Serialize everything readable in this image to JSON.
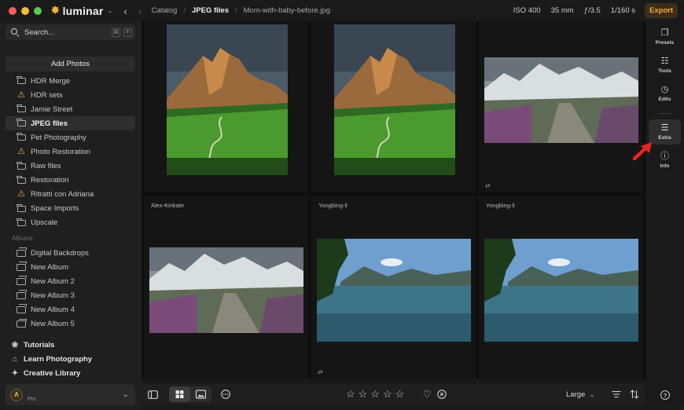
{
  "app": {
    "name": "luminar",
    "logo_glyph": "✸"
  },
  "breadcrumbs": [
    "Catalog",
    "JPEG files",
    "Mom-with-baby-before.jpg"
  ],
  "exif": {
    "iso": "ISO 400",
    "focal": "35 mm",
    "aperture": "ƒ/3.5",
    "shutter": "1/160 s"
  },
  "toolbar": {
    "export_label": "Export"
  },
  "search": {
    "placeholder": "Search...",
    "key1": "⌘",
    "key2": "F"
  },
  "sidebar": {
    "add_photos": "Add Photos",
    "folders": [
      {
        "label": "HDR Merge",
        "icon": "folder-icon"
      },
      {
        "label": "HDR sets",
        "icon": "warning-icon"
      },
      {
        "label": "Jamie Street",
        "icon": "folder-icon"
      },
      {
        "label": "JPEG files",
        "icon": "folder-icon",
        "active": true
      },
      {
        "label": "Pet Photography",
        "icon": "folder-icon"
      },
      {
        "label": "Photo Restoration",
        "icon": "warning-icon"
      },
      {
        "label": "Raw files",
        "icon": "folder-icon"
      },
      {
        "label": "Restoration",
        "icon": "folder-icon"
      },
      {
        "label": "Ritratti con Adriana",
        "icon": "warning-icon"
      },
      {
        "label": "Space Imports",
        "icon": "folder-icon"
      },
      {
        "label": "Upscale",
        "icon": "folder-icon"
      }
    ],
    "albums_heading": "Albums",
    "albums": [
      "Digital Backdrops",
      "New Album",
      "New Album 2",
      "New Album 3",
      "New Album 4",
      "New Album 5"
    ],
    "learn": [
      {
        "label": "Tutorials",
        "icon": "tutorials-icon"
      },
      {
        "label": "Learn Photography",
        "icon": "learn-icon"
      },
      {
        "label": "Creative Library",
        "icon": "library-icon"
      }
    ],
    "profile": {
      "initial": "A",
      "tier": "Pro"
    }
  },
  "grid": {
    "cells": [
      {
        "label": "",
        "photo": "mountain",
        "adjusted": false
      },
      {
        "label": "",
        "photo": "mountain",
        "adjusted": false
      },
      {
        "label": "",
        "photo": "snow",
        "adjusted": true
      },
      {
        "label": "Alex-Kinkate",
        "photo": "snow",
        "adjusted": false
      },
      {
        "label": "Yongbing-li",
        "photo": "lake",
        "adjusted": true
      },
      {
        "label": "Yongbing-li",
        "photo": "lake",
        "adjusted": false
      }
    ],
    "adjust_glyph": "⇄"
  },
  "rightbar": {
    "tools": [
      {
        "label": "Presets",
        "icon": "presets-icon",
        "glyph": "❐"
      },
      {
        "label": "Tools",
        "icon": "tools-icon",
        "glyph": "☷"
      },
      {
        "label": "Edits",
        "icon": "edits-icon",
        "glyph": "◷"
      },
      {
        "label": "Extra",
        "icon": "extra-icon",
        "glyph": "☰",
        "active": true
      },
      {
        "label": "Info",
        "icon": "info-icon",
        "glyph": "ⓘ"
      }
    ],
    "help": "?"
  },
  "bottombar": {
    "size_label": "Large",
    "star_glyph": "☆",
    "star_count": 5
  },
  "colors": {
    "accent": "#f5a83c",
    "warning": "#f2a544",
    "annotation_arrow": "#e8241e"
  }
}
